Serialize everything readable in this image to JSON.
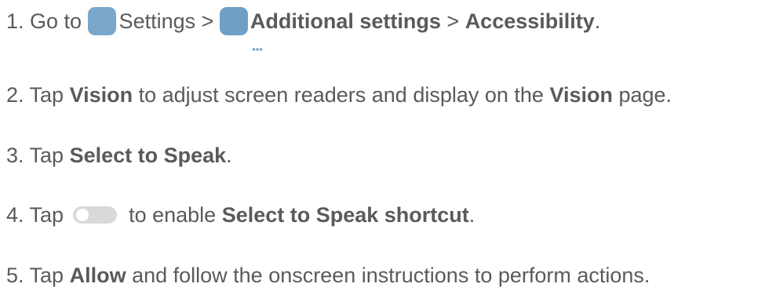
{
  "colors": {
    "text": "#5a5a5a",
    "settings_icon_bg": "#7aa6c9",
    "additional_icon_bg": "#6f9fc4",
    "toggle_track": "#d9d9d9"
  },
  "icons": {
    "settings": "settings-gear-icon",
    "additional_settings": "ellipsis-chat-icon",
    "toggle": "toggle-off-icon"
  },
  "steps": [
    {
      "prefix": "1. Go to ",
      "settings": "Settings",
      "sep1": " > ",
      "additional": "Additional settings",
      "sep2": " > ",
      "accessibility": "Accessibility",
      "end": "."
    },
    {
      "prefix": "2. Tap ",
      "vision1": "Vision",
      "middle": " to adjust screen readers and display on the ",
      "vision2": "Vision",
      "end": " page."
    },
    {
      "prefix": "3. Tap ",
      "select": "Select to Speak",
      "end": "."
    },
    {
      "prefix": "4. Tap ",
      "middle": " to enable ",
      "shortcut": "Select to Speak shortcut",
      "end": "."
    },
    {
      "prefix": "5. Tap ",
      "allow": "Allow",
      "end": " and follow the onscreen instructions to perform actions."
    }
  ]
}
